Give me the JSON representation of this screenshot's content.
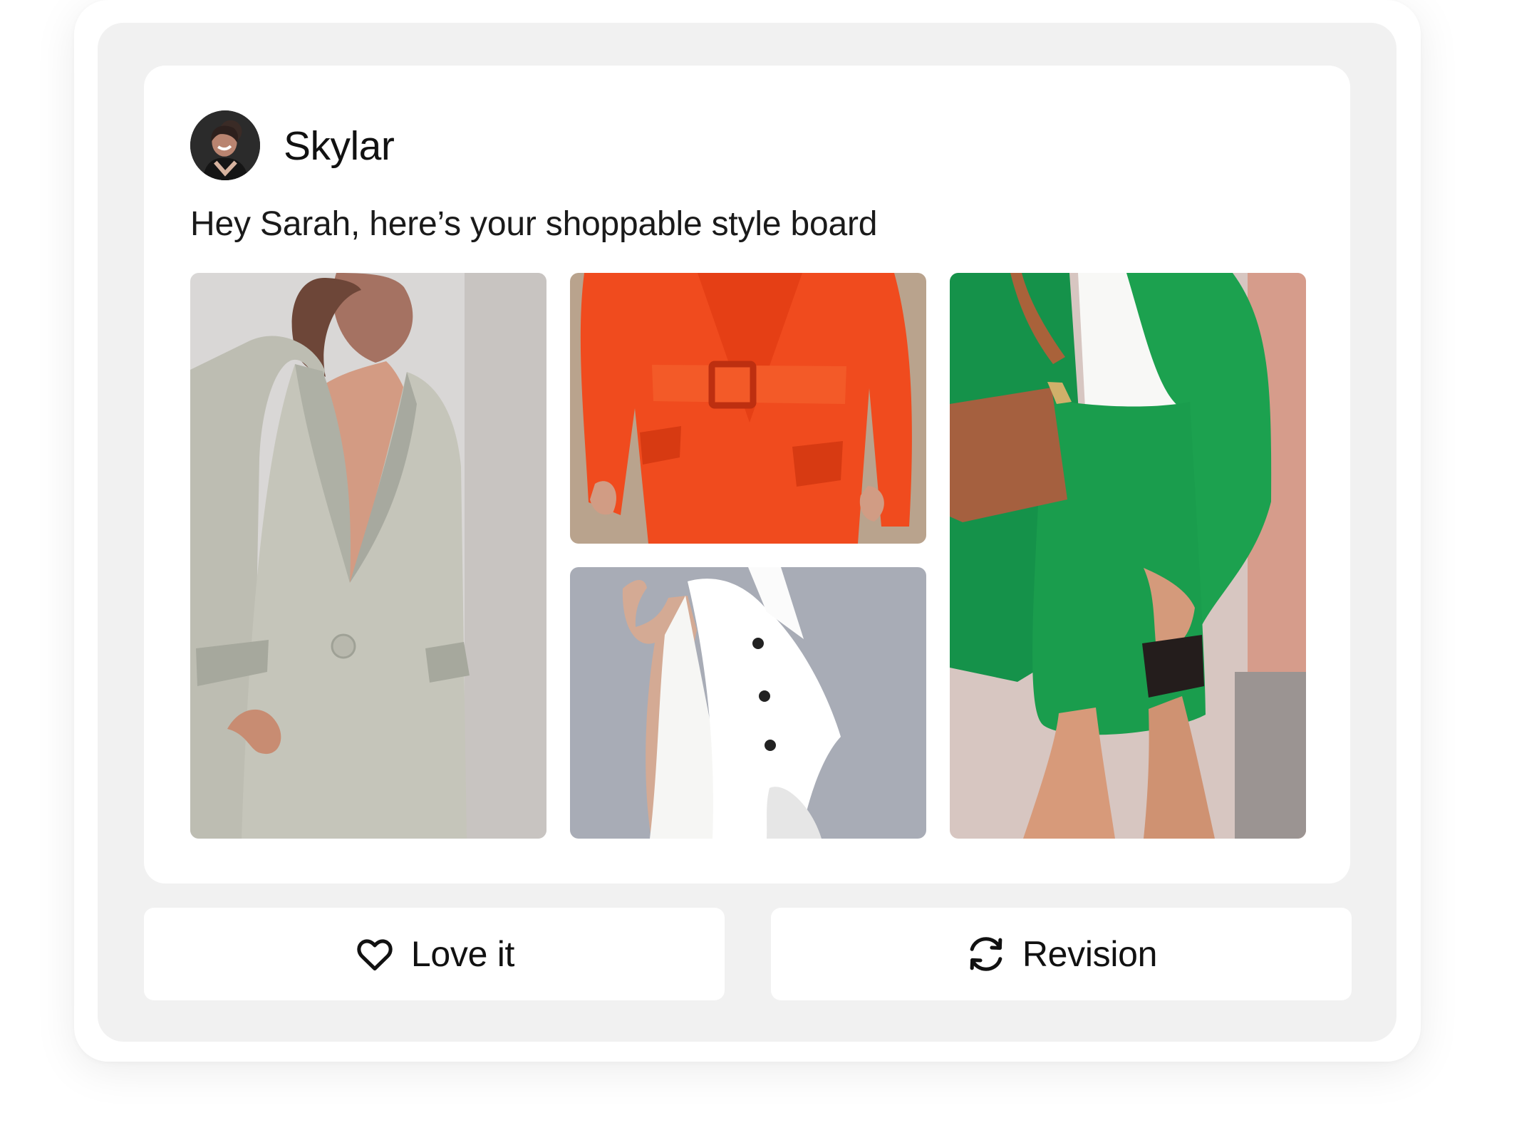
{
  "message": {
    "sender_name": "Skylar",
    "text": "Hey Sarah, here’s your shoppable style board"
  },
  "style_board": {
    "items": [
      {
        "name": "grey-blazer-photo",
        "palette": [
          "#d8d6d4",
          "#bfc1b4"
        ]
      },
      {
        "name": "orange-belted-blazer-photo",
        "palette": [
          "#b7a38e",
          "#f04a1b"
        ]
      },
      {
        "name": "white-dress-blazer-photo",
        "palette": [
          "#a9adb6",
          "#f7f7f5"
        ]
      },
      {
        "name": "green-linen-set-photo",
        "palette": [
          "#d9c7bf",
          "#1f9a45"
        ]
      }
    ]
  },
  "actions": {
    "love_label": "Love it",
    "love_icon": "heart-icon",
    "revision_label": "Revision",
    "revision_icon": "refresh-icon"
  }
}
